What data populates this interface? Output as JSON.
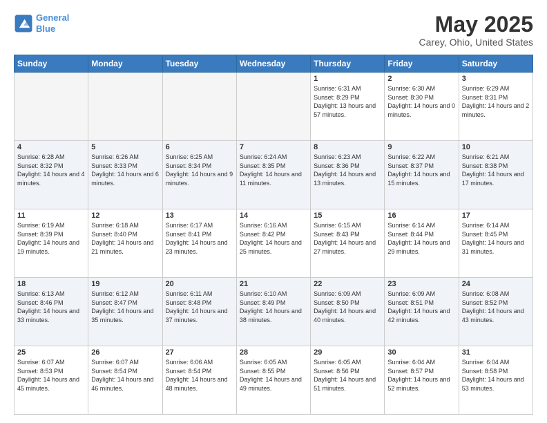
{
  "logo": {
    "line1": "General",
    "line2": "Blue"
  },
  "title": "May 2025",
  "subtitle": "Carey, Ohio, United States",
  "days_header": [
    "Sunday",
    "Monday",
    "Tuesday",
    "Wednesday",
    "Thursday",
    "Friday",
    "Saturday"
  ],
  "weeks": [
    [
      {
        "day": "",
        "sunrise": "",
        "sunset": "",
        "daylight": "",
        "empty": true
      },
      {
        "day": "",
        "sunrise": "",
        "sunset": "",
        "daylight": "",
        "empty": true
      },
      {
        "day": "",
        "sunrise": "",
        "sunset": "",
        "daylight": "",
        "empty": true
      },
      {
        "day": "",
        "sunrise": "",
        "sunset": "",
        "daylight": "",
        "empty": true
      },
      {
        "day": "1",
        "sunrise": "Sunrise: 6:31 AM",
        "sunset": "Sunset: 8:29 PM",
        "daylight": "Daylight: 13 hours and 57 minutes."
      },
      {
        "day": "2",
        "sunrise": "Sunrise: 6:30 AM",
        "sunset": "Sunset: 8:30 PM",
        "daylight": "Daylight: 14 hours and 0 minutes."
      },
      {
        "day": "3",
        "sunrise": "Sunrise: 6:29 AM",
        "sunset": "Sunset: 8:31 PM",
        "daylight": "Daylight: 14 hours and 2 minutes."
      }
    ],
    [
      {
        "day": "4",
        "sunrise": "Sunrise: 6:28 AM",
        "sunset": "Sunset: 8:32 PM",
        "daylight": "Daylight: 14 hours and 4 minutes."
      },
      {
        "day": "5",
        "sunrise": "Sunrise: 6:26 AM",
        "sunset": "Sunset: 8:33 PM",
        "daylight": "Daylight: 14 hours and 6 minutes."
      },
      {
        "day": "6",
        "sunrise": "Sunrise: 6:25 AM",
        "sunset": "Sunset: 8:34 PM",
        "daylight": "Daylight: 14 hours and 9 minutes."
      },
      {
        "day": "7",
        "sunrise": "Sunrise: 6:24 AM",
        "sunset": "Sunset: 8:35 PM",
        "daylight": "Daylight: 14 hours and 11 minutes."
      },
      {
        "day": "8",
        "sunrise": "Sunrise: 6:23 AM",
        "sunset": "Sunset: 8:36 PM",
        "daylight": "Daylight: 14 hours and 13 minutes."
      },
      {
        "day": "9",
        "sunrise": "Sunrise: 6:22 AM",
        "sunset": "Sunset: 8:37 PM",
        "daylight": "Daylight: 14 hours and 15 minutes."
      },
      {
        "day": "10",
        "sunrise": "Sunrise: 6:21 AM",
        "sunset": "Sunset: 8:38 PM",
        "daylight": "Daylight: 14 hours and 17 minutes."
      }
    ],
    [
      {
        "day": "11",
        "sunrise": "Sunrise: 6:19 AM",
        "sunset": "Sunset: 8:39 PM",
        "daylight": "Daylight: 14 hours and 19 minutes."
      },
      {
        "day": "12",
        "sunrise": "Sunrise: 6:18 AM",
        "sunset": "Sunset: 8:40 PM",
        "daylight": "Daylight: 14 hours and 21 minutes."
      },
      {
        "day": "13",
        "sunrise": "Sunrise: 6:17 AM",
        "sunset": "Sunset: 8:41 PM",
        "daylight": "Daylight: 14 hours and 23 minutes."
      },
      {
        "day": "14",
        "sunrise": "Sunrise: 6:16 AM",
        "sunset": "Sunset: 8:42 PM",
        "daylight": "Daylight: 14 hours and 25 minutes."
      },
      {
        "day": "15",
        "sunrise": "Sunrise: 6:15 AM",
        "sunset": "Sunset: 8:43 PM",
        "daylight": "Daylight: 14 hours and 27 minutes."
      },
      {
        "day": "16",
        "sunrise": "Sunrise: 6:14 AM",
        "sunset": "Sunset: 8:44 PM",
        "daylight": "Daylight: 14 hours and 29 minutes."
      },
      {
        "day": "17",
        "sunrise": "Sunrise: 6:14 AM",
        "sunset": "Sunset: 8:45 PM",
        "daylight": "Daylight: 14 hours and 31 minutes."
      }
    ],
    [
      {
        "day": "18",
        "sunrise": "Sunrise: 6:13 AM",
        "sunset": "Sunset: 8:46 PM",
        "daylight": "Daylight: 14 hours and 33 minutes."
      },
      {
        "day": "19",
        "sunrise": "Sunrise: 6:12 AM",
        "sunset": "Sunset: 8:47 PM",
        "daylight": "Daylight: 14 hours and 35 minutes."
      },
      {
        "day": "20",
        "sunrise": "Sunrise: 6:11 AM",
        "sunset": "Sunset: 8:48 PM",
        "daylight": "Daylight: 14 hours and 37 minutes."
      },
      {
        "day": "21",
        "sunrise": "Sunrise: 6:10 AM",
        "sunset": "Sunset: 8:49 PM",
        "daylight": "Daylight: 14 hours and 38 minutes."
      },
      {
        "day": "22",
        "sunrise": "Sunrise: 6:09 AM",
        "sunset": "Sunset: 8:50 PM",
        "daylight": "Daylight: 14 hours and 40 minutes."
      },
      {
        "day": "23",
        "sunrise": "Sunrise: 6:09 AM",
        "sunset": "Sunset: 8:51 PM",
        "daylight": "Daylight: 14 hours and 42 minutes."
      },
      {
        "day": "24",
        "sunrise": "Sunrise: 6:08 AM",
        "sunset": "Sunset: 8:52 PM",
        "daylight": "Daylight: 14 hours and 43 minutes."
      }
    ],
    [
      {
        "day": "25",
        "sunrise": "Sunrise: 6:07 AM",
        "sunset": "Sunset: 8:53 PM",
        "daylight": "Daylight: 14 hours and 45 minutes."
      },
      {
        "day": "26",
        "sunrise": "Sunrise: 6:07 AM",
        "sunset": "Sunset: 8:54 PM",
        "daylight": "Daylight: 14 hours and 46 minutes."
      },
      {
        "day": "27",
        "sunrise": "Sunrise: 6:06 AM",
        "sunset": "Sunset: 8:54 PM",
        "daylight": "Daylight: 14 hours and 48 minutes."
      },
      {
        "day": "28",
        "sunrise": "Sunrise: 6:05 AM",
        "sunset": "Sunset: 8:55 PM",
        "daylight": "Daylight: 14 hours and 49 minutes."
      },
      {
        "day": "29",
        "sunrise": "Sunrise: 6:05 AM",
        "sunset": "Sunset: 8:56 PM",
        "daylight": "Daylight: 14 hours and 51 minutes."
      },
      {
        "day": "30",
        "sunrise": "Sunrise: 6:04 AM",
        "sunset": "Sunset: 8:57 PM",
        "daylight": "Daylight: 14 hours and 52 minutes."
      },
      {
        "day": "31",
        "sunrise": "Sunrise: 6:04 AM",
        "sunset": "Sunset: 8:58 PM",
        "daylight": "Daylight: 14 hours and 53 minutes."
      }
    ]
  ]
}
